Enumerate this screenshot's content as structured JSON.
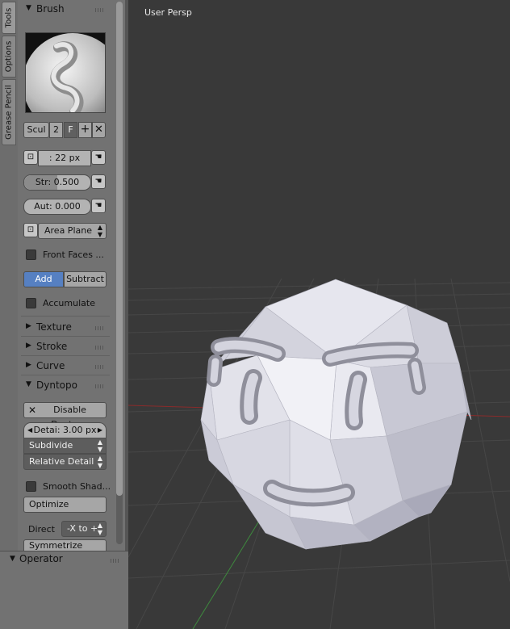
{
  "tabs": [
    "Tools",
    "Options",
    "Grease Pencil"
  ],
  "brush": {
    "header": "Brush",
    "name_field": "Scul",
    "users": "2",
    "fake_user": "F",
    "radius": ": 22 px",
    "strength": "Str:  0.500",
    "strength_value": 0.5,
    "autosmooth": "Aut:  0.000",
    "autosmooth_value": 0.0,
    "sculpt_plane": "Area Plane",
    "front_faces": "Front Faces ...",
    "direction_add": "Add",
    "direction_subtract": "Subtract",
    "accumulate": "Accumulate"
  },
  "sections": {
    "texture": "Texture",
    "stroke": "Stroke",
    "curve": "Curve",
    "dyntopo": "Dyntopo"
  },
  "dyntopo": {
    "toggle": "Disable Dyntopo",
    "detail": "Detai: 3.00 px",
    "method": "Subdivide Colla...",
    "detailing": "Relative Detail",
    "smooth_shading": "Smooth Shad...",
    "optimize": "Optimize",
    "direction_label": "Direct",
    "direction_value": "-X to +",
    "symmetrize": "Symmetrize"
  },
  "operator": {
    "header": "Operator"
  },
  "viewport": {
    "label": "User Persp"
  },
  "colors": {
    "panel_bg": "#727272",
    "viewport_bg": "#393939",
    "active_blue": "#5680c2",
    "mesh": "#c9c9d4",
    "axis_x": "#8a2b2b",
    "axis_y": "#3e8a3e"
  }
}
